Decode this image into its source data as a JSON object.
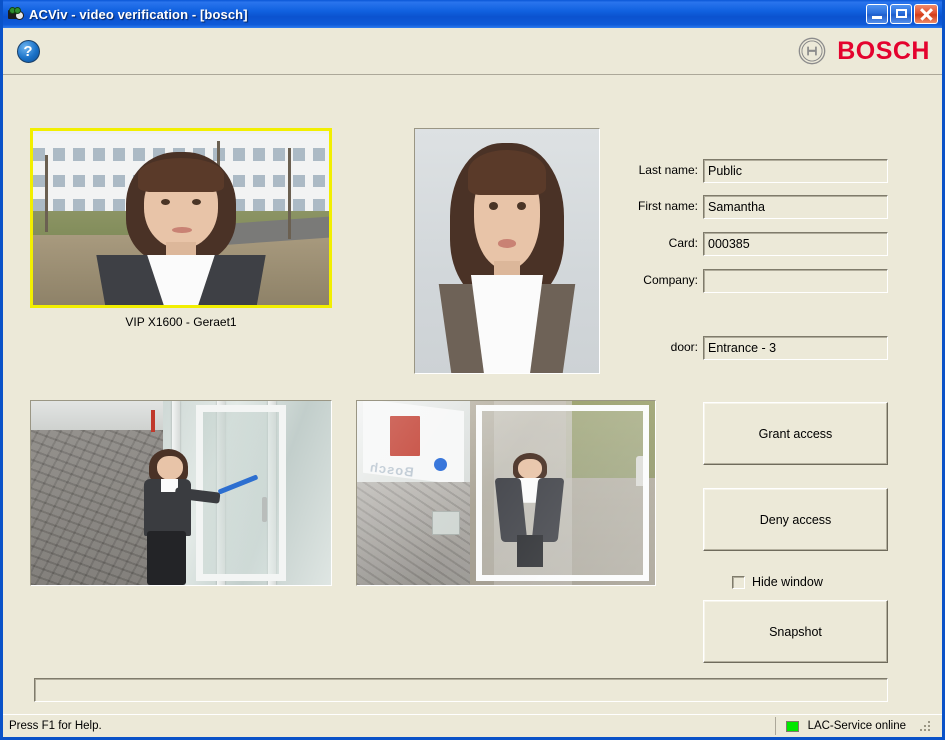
{
  "window": {
    "title": "ACViv - video verification - [bosch]",
    "icon": "video-camera-icon",
    "minimize_label": "",
    "maximize_label": "",
    "close_label": ""
  },
  "toolbar": {
    "help_label": "?",
    "brand": "BOSCH"
  },
  "videos": {
    "live_camera": {
      "caption": "VIP X1600 - Geraet1",
      "active_border_color": "#f2ef00"
    },
    "id_photo": {
      "caption": ""
    },
    "door_camera": {
      "caption": ""
    },
    "overhead_camera": {
      "caption": ""
    }
  },
  "form": {
    "fields": [
      {
        "label": "Last name:",
        "value": "Public"
      },
      {
        "label": "First name:",
        "value": "Samantha"
      },
      {
        "label": "Card:",
        "value": "000385"
      },
      {
        "label": "Company:",
        "value": ""
      }
    ],
    "door": {
      "label": "door:",
      "value": "Entrance - 3"
    }
  },
  "actions": {
    "grant": "Grant access",
    "deny": "Deny access",
    "hide_window": "Hide window",
    "hide_window_checked": false,
    "snapshot": "Snapshot"
  },
  "message_bar": {
    "text": ""
  },
  "statusbar": {
    "hint": "Press F1 for Help.",
    "service_status": "LAC-Service online",
    "led_color": "#00e800"
  }
}
